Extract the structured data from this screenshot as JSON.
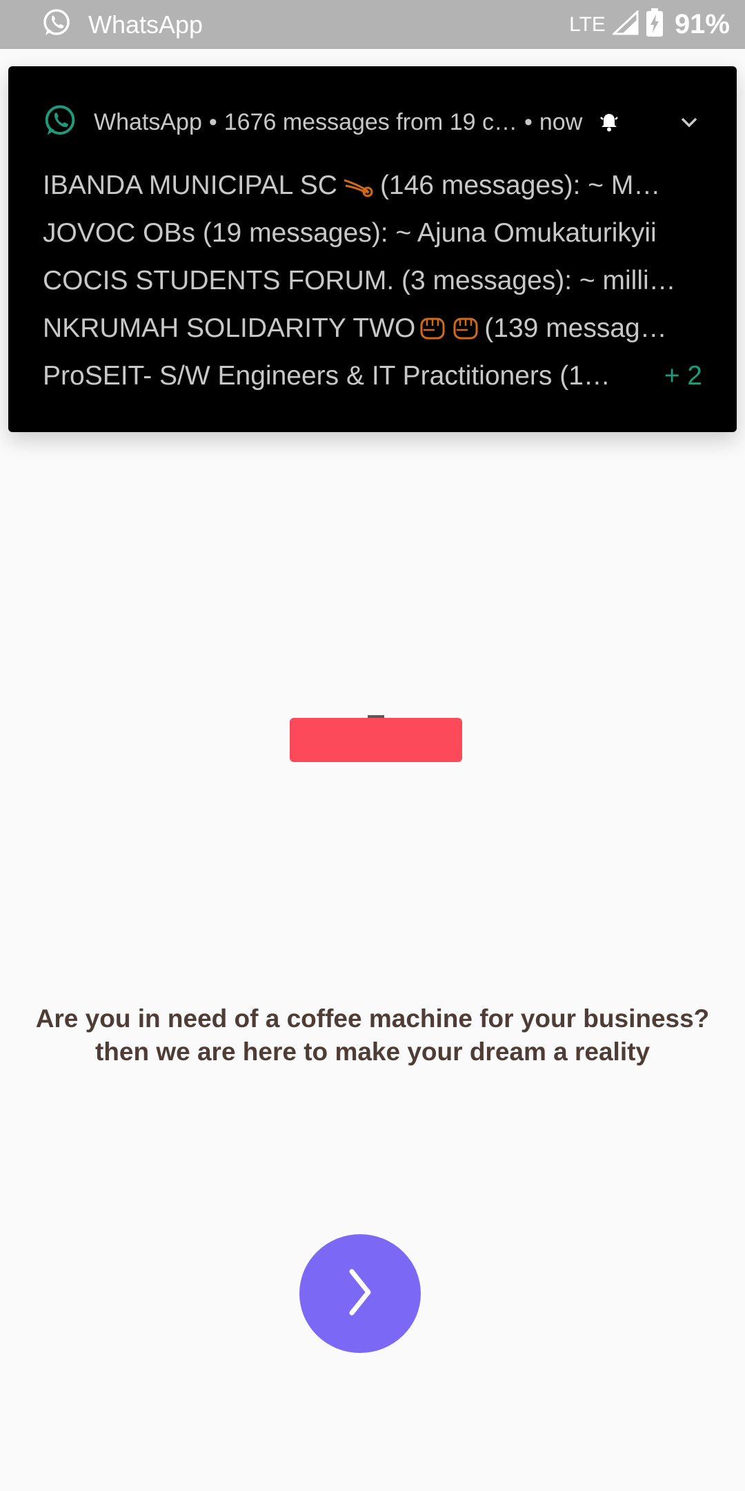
{
  "status_bar": {
    "app_name": "WhatsApp",
    "network": "LTE",
    "battery": "91%",
    "icons": [
      "whatsapp-icon",
      "signal-icon",
      "battery-charging-icon"
    ]
  },
  "notification": {
    "app_name": "WhatsApp",
    "summary": "1676 messages from 19 c…",
    "time": "now",
    "separator": "•",
    "icons": [
      "whatsapp-icon",
      "bell-icon",
      "chevron-down-icon"
    ],
    "lines": [
      {
        "text": "IBANDA MUNICIPAL SC",
        "emoji": "comet-icon",
        "suffix": "(146 messages): ~ M…"
      },
      {
        "text": "JOVOC OBs (19 messages): ~ Ajuna Omukaturikyii"
      },
      {
        "text": "COCIS STUDENTS FORUM. (3 messages): ~ milli…"
      },
      {
        "text": "NKRUMAH SOLIDARITY TWO",
        "emoji": "raised-fist-icon",
        "suffix": "(139 messag…"
      },
      {
        "text": "ProSEIT-  S/W Engineers & IT Practitioners (1…",
        "more": "+ 2"
      }
    ],
    "colors": {
      "accent": "#1e9a7a",
      "background": "#000000",
      "text": "#c8c8c8"
    }
  },
  "main": {
    "tagline_line1": "Are you in need of a coffee machine for your business?",
    "tagline_line2": "then we are here to make your dream a reality",
    "next_icon": "chevron-right-icon",
    "colors": {
      "banner": "#fc4a5b",
      "button": "#7b69f5",
      "text": "#4e3c37"
    }
  }
}
